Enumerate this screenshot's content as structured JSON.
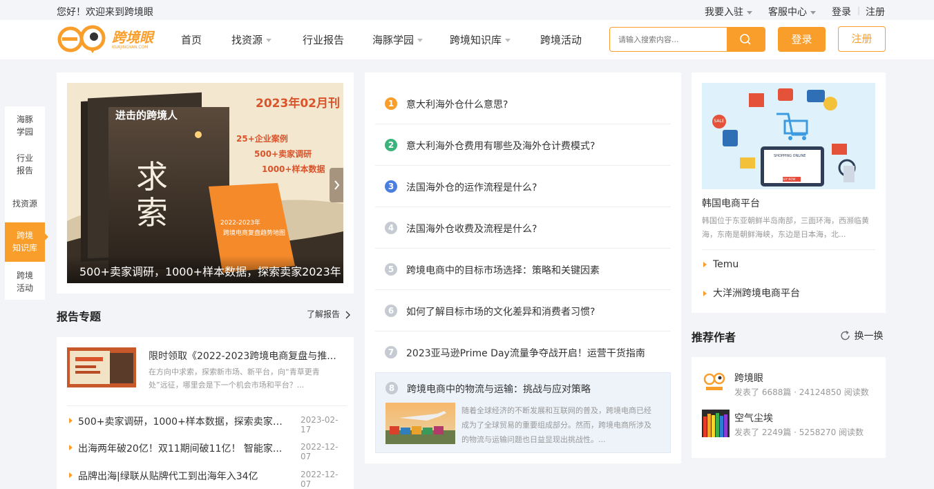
{
  "topbar": {
    "welcome": "您好！欢迎来到跨境眼",
    "join": "我要入驻",
    "service": "客服中心",
    "login": "登录",
    "sep": "|",
    "register": "注册"
  },
  "logo": {
    "text": "跨境眼",
    "sub": "KUAJINGYAN.COM"
  },
  "nav": {
    "items": [
      {
        "label": "首页",
        "dropdown": false
      },
      {
        "label": "找资源",
        "dropdown": true
      },
      {
        "label": "行业报告",
        "dropdown": false
      },
      {
        "label": "海豚学园",
        "dropdown": true
      },
      {
        "label": "跨境知识库",
        "dropdown": true
      },
      {
        "label": "跨境活动",
        "dropdown": false
      }
    ]
  },
  "search": {
    "placeholder": "请输入搜索内容..."
  },
  "header_buttons": {
    "login": "登录",
    "register": "注册"
  },
  "sidenav": {
    "items": [
      {
        "l1": "海豚",
        "l2": "学园"
      },
      {
        "l1": "行业",
        "l2": "报告"
      },
      {
        "l1": "找资源",
        "l2": ""
      },
      {
        "l1": "跨境",
        "l2": "知识库"
      },
      {
        "l1": "跨境",
        "l2": "活动"
      }
    ],
    "active_index": 3
  },
  "banner": {
    "issue": "2023年02月刊",
    "book_title": "进击的跨境人",
    "book_big": "求索",
    "points": [
      "25+企业案例",
      "500+卖家调研",
      "1000+样本数据"
    ],
    "orange_book_l1": "2022-2023年",
    "orange_book_l2": "跨境电商复盘趋势地图",
    "caption": "500+卖家调研，1000+样本数据，探索卖家2023年"
  },
  "reports": {
    "title": "报告专题",
    "more": "了解报告",
    "featured": {
      "title": "限时领取《2022-2023跨境电商复盘与推...",
      "desc": "在方向中求索，探索新市场、新平台，向“青草更青处”远征，哪里会是下一个机会市场和平台？..."
    },
    "list": [
      {
        "title": "500+卖家调研，1000+样本数据，探索卖家2...",
        "date": "2023-02-17"
      },
      {
        "title": "出海两年破20亿！双11期间破11亿！ 智能家...",
        "date": "2022-12-07"
      },
      {
        "title": "品牌出海|绿联从贴牌代工到出海年入34亿",
        "date": "2022-12-07"
      }
    ]
  },
  "questions": {
    "items": [
      {
        "n": "1",
        "text": "意大利海外仓什么意思?",
        "color": "#f99e2b"
      },
      {
        "n": "2",
        "text": "意大利海外仓费用有哪些及海外仓计费模式?",
        "color": "#3cb37a"
      },
      {
        "n": "3",
        "text": "法国海外仓的运作流程是什么?",
        "color": "#4a7fe0"
      },
      {
        "n": "4",
        "text": "法国海外仓收费及流程是什么?",
        "color": "#c5cad3"
      },
      {
        "n": "5",
        "text": "跨境电商中的目标市场选择：策略和关键因素",
        "color": "#c5cad3"
      },
      {
        "n": "6",
        "text": "如何了解目标市场的文化差异和消费者习惯?",
        "color": "#c5cad3"
      },
      {
        "n": "7",
        "text": "2023亚马逊Prime Day流量争夺战开启！运营干货指南",
        "color": "#c5cad3"
      }
    ],
    "expanded": {
      "n": "8",
      "text": "跨境电商中的物流与运输：挑战与应对策略",
      "color": "#c5cad3",
      "desc": "随着全球经济的不断发展和互联网的普及，跨境电商已经成为了全球贸易的重要组成部分。然而，跨境电商所涉及的物流与运输问题也日益显现出挑战性。..."
    }
  },
  "platform": {
    "title": "韩国电商平台",
    "desc": "韩国位于东亚朝鲜半岛南部，三面环海，西濒临黄海，东南是朝鲜海峡，东边是日本海，北...",
    "links": [
      "Temu",
      "大洋洲跨境电商平台"
    ],
    "img_text": "SHOPPING ONLINE",
    "img_btn": "BUY NOW",
    "sale": "SALE"
  },
  "authors": {
    "title": "推荐作者",
    "refresh": "换一换",
    "items": [
      {
        "name": "跨境眼",
        "stats": "发表了 6688篇 · 24124850 阅读数"
      },
      {
        "name": "空气尘埃",
        "stats": "发表了 2249篇 · 5258270 阅读数"
      }
    ]
  },
  "colors": {
    "accent": "#f99e2b",
    "bg": "#f2f4f7"
  }
}
